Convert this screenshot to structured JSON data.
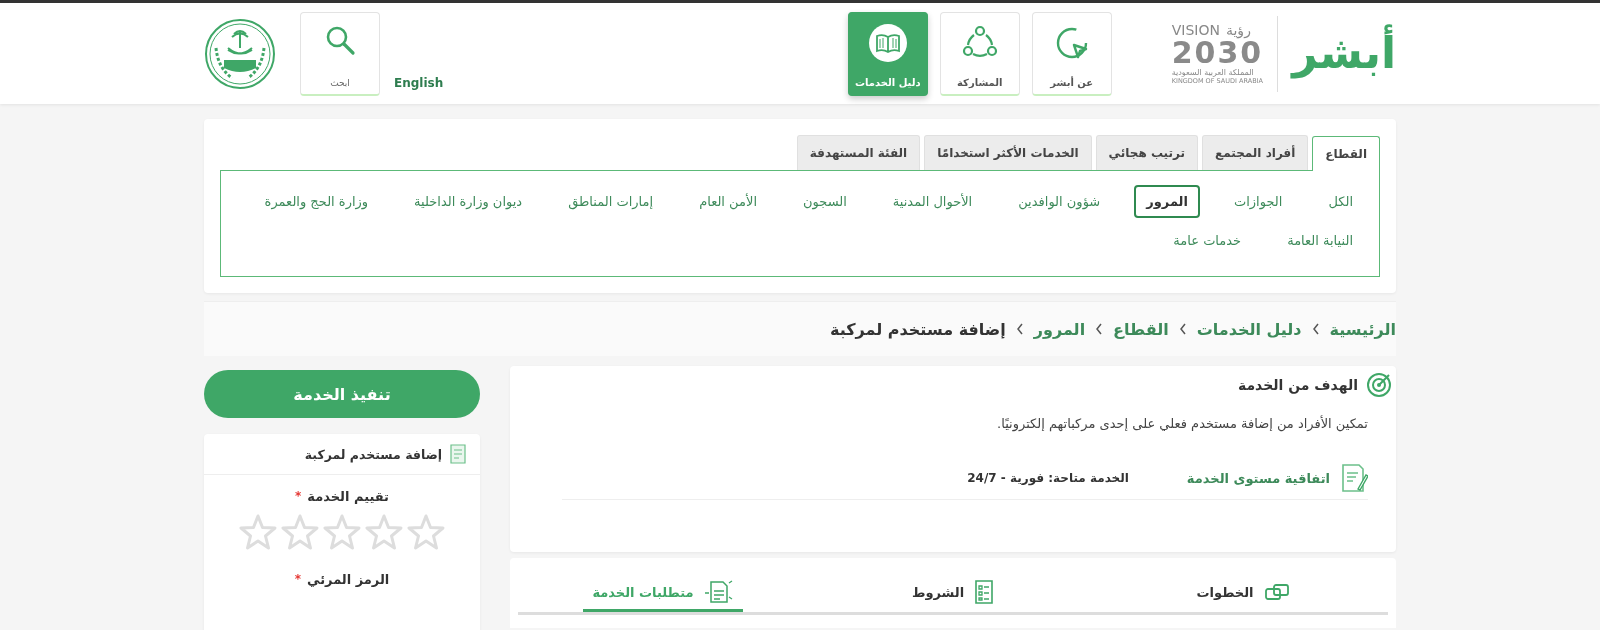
{
  "header": {
    "brand": "أبشر",
    "vision": {
      "word": "VISION",
      "arabic": "رؤية",
      "year": "2030",
      "country_ar": "المملكة العربية السعودية",
      "country_en": "KINGDOM OF SAUDI ARABIA"
    },
    "nav": [
      {
        "label": "عن أبشر",
        "selected": false
      },
      {
        "label": "المشاركة",
        "selected": false
      },
      {
        "label": "دليل الخدمات",
        "selected": true
      }
    ],
    "language": "English",
    "search": "ابحث"
  },
  "sectors": {
    "tabs": [
      {
        "label": "القطاع",
        "selected": true
      },
      {
        "label": "أفراد المجتمع",
        "selected": false
      },
      {
        "label": "ترتيب هجائي",
        "selected": false
      },
      {
        "label": "الخدمات الأكثر استخدامًا",
        "selected": false
      },
      {
        "label": "الفئة المستهدفة",
        "selected": false
      }
    ],
    "items": [
      {
        "label": "الكل",
        "selected": false
      },
      {
        "label": "الجوازات",
        "selected": false
      },
      {
        "label": "المرور",
        "selected": true
      },
      {
        "label": "شؤون الوافدين",
        "selected": false
      },
      {
        "label": "الأحوال المدنية",
        "selected": false
      },
      {
        "label": "السجون",
        "selected": false
      },
      {
        "label": "الأمن العام",
        "selected": false
      },
      {
        "label": "إمارات المناطق",
        "selected": false
      },
      {
        "label": "ديوان وزارة الداخلية",
        "selected": false
      },
      {
        "label": "وزارة الحج والعمرة",
        "selected": false
      },
      {
        "label": "النيابة العامة",
        "selected": false
      },
      {
        "label": "خدمات عامة",
        "selected": false
      }
    ]
  },
  "breadcrumb": [
    "الرئيسية",
    "دليل الخدمات",
    "القطاع",
    "المرور",
    "إضافة مستخدم لمركبة"
  ],
  "goal": {
    "title": "الهدف من الخدمة",
    "text": "تمكين الأفراد من إضافة مستخدم فعلي على إحدى مركباتهم إلكترونيًا.",
    "sla_label": "اتفاقية مستوى الخدمة",
    "sla_value": "الخدمة متاحة: فورية - 24/7"
  },
  "detail_tabs": [
    {
      "label": "الخطوات",
      "selected": false
    },
    {
      "label": "الشروط",
      "selected": false
    },
    {
      "label": "متطلبات الخدمة",
      "selected": true
    }
  ],
  "side": {
    "button": "تنفيذ الخدمة",
    "title": "إضافة مستخدم لمركبة",
    "rating": {
      "label": "تقييم الخدمة",
      "required": "*",
      "stars": 0
    },
    "captcha": {
      "label": "الرمز المرئي",
      "required": "*"
    }
  }
}
